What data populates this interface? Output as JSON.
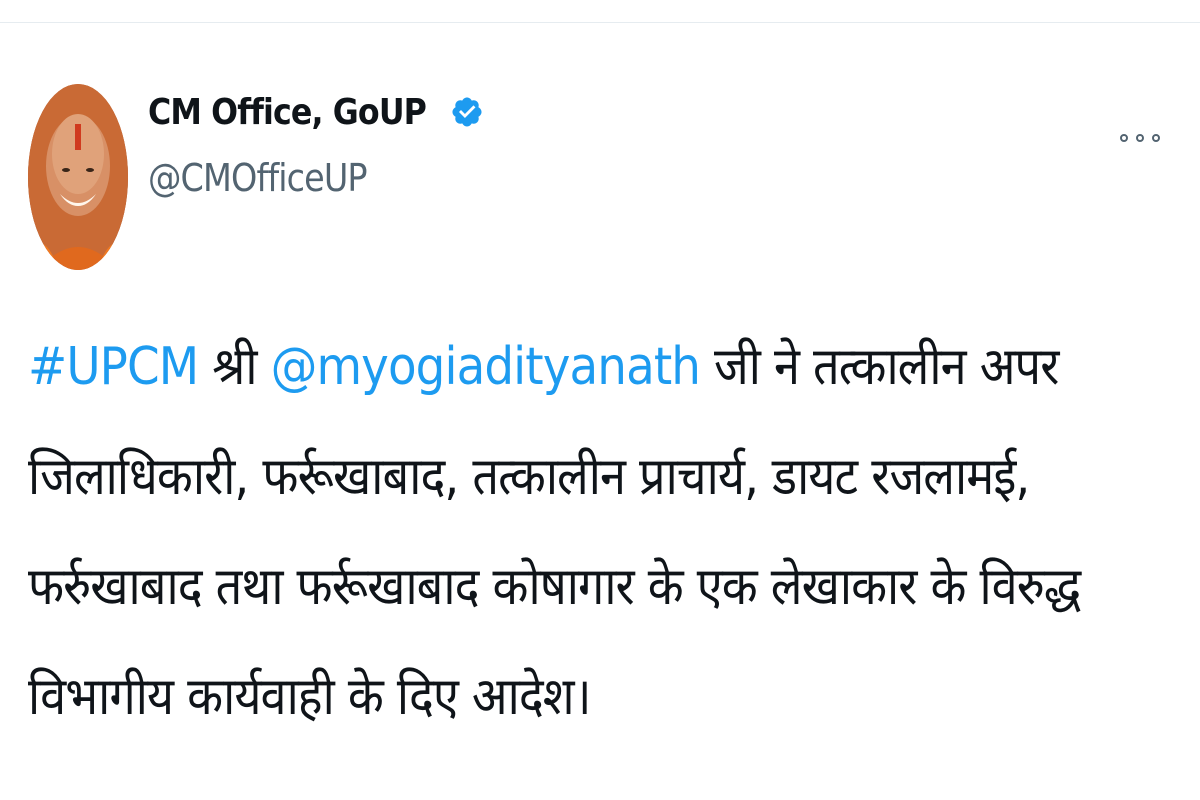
{
  "author": {
    "display_name": "CM Office, GoUP",
    "handle": "@CMOfficeUP",
    "verified": true,
    "avatar": "profile-photo"
  },
  "menu": {
    "icon": "more-options-icon"
  },
  "tweet": {
    "line1_hashtag": "#UPCM",
    "line1_mid": " श्री ",
    "line1_mention": "@myogiadityanath",
    "line1_rest": " जी ने तत्कालीन अपर",
    "line2": "जिलाधिकारी, फर्रूखाबाद, तत्कालीन प्राचार्य, डायट रजलामई,",
    "line3": "फर्रुखाबाद तथा फर्रूखाबाद कोषागार के एक लेखाकार के विरुद्ध",
    "line4": "विभागीय कार्यवाही के दिए आदेश।"
  },
  "colors": {
    "link": "#1d9bf0",
    "text": "#0f1419",
    "secondary": "#536471",
    "verified": "#1d9bf0"
  }
}
